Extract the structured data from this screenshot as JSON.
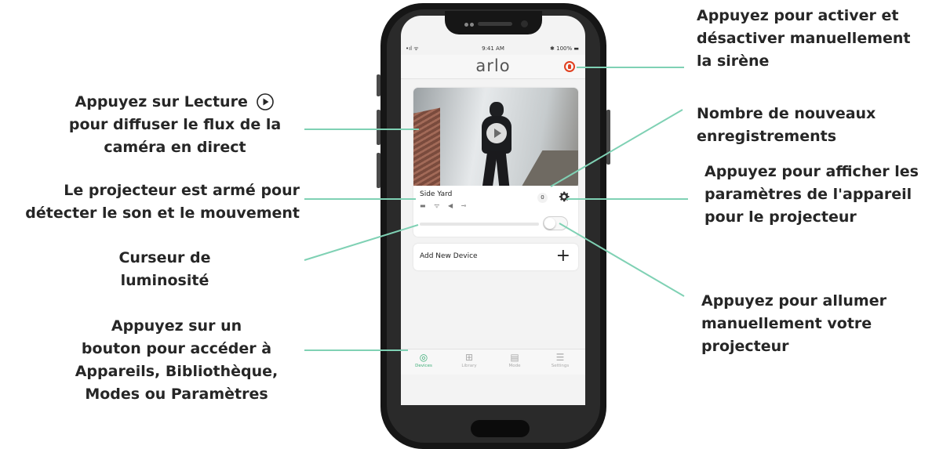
{
  "callouts": {
    "siren": [
      "Appuyez pour activer et",
      "désactiver manuellement",
      "la sirène"
    ],
    "play": [
      "Appuyez sur Lecture",
      "pour diffuser le flux de la",
      "caméra en direct"
    ],
    "recordings": [
      "Nombre de nouveaux",
      "enregistrements"
    ],
    "settings": [
      "Appuyez pour afficher les",
      "paramètres de l'appareil",
      "pour le projecteur"
    ],
    "armed": [
      "Le projecteur est armé pour",
      "détecter le son et le mouvement"
    ],
    "brightness": [
      "Curseur de",
      "luminosité"
    ],
    "light_toggle": [
      "Appuyez pour allumer",
      "manuellement votre",
      "projecteur"
    ],
    "nav": [
      "Appuyez sur un",
      "bouton pour accéder à",
      "Appareils, Bibliothèque,",
      "Modes ou Paramètres"
    ]
  },
  "statusbar": {
    "signal": "•ıl ᯤ",
    "time": "9:41 AM",
    "battery": "✱ 100% ▬"
  },
  "app": {
    "logo": "arlo",
    "camera_name": "Side Yard",
    "new_recordings": "0",
    "add_device_label": "Add New Device",
    "add_device_icon": "plus-icon",
    "tabs": [
      {
        "label": "Devices",
        "icon": "devices-icon",
        "active": true
      },
      {
        "label": "Library",
        "icon": "library-grid-icon",
        "active": false
      },
      {
        "label": "Mode",
        "icon": "mode-icon",
        "active": false
      },
      {
        "label": "Settings",
        "icon": "settings-menu-icon",
        "active": false
      }
    ]
  },
  "colors": {
    "accent": "#3dad77",
    "siren": "#e1401f",
    "leader_line": "#7fd1b4",
    "text": "#262626"
  }
}
